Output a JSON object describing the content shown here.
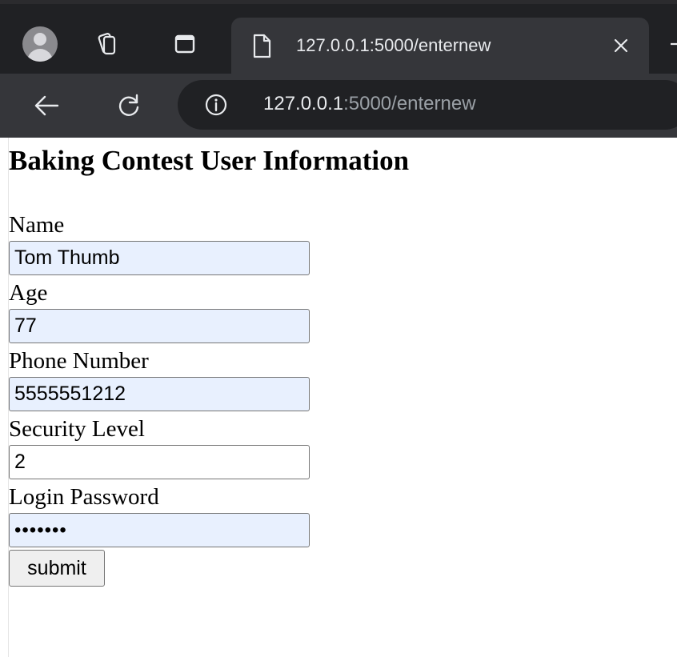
{
  "browser": {
    "tab_title": "127.0.0.1:5000/enternew",
    "url_host": "127.0.0.1",
    "url_rest": ":5000/enternew",
    "icons": [
      "profile-avatar",
      "collections-icon",
      "tab-actions-icon",
      "page-document-icon",
      "close-icon",
      "back-arrow-icon",
      "reload-icon",
      "site-info-icon"
    ]
  },
  "page": {
    "heading": "Baking Contest User Information",
    "fields": {
      "name": {
        "label": "Name",
        "value": "Tom Thumb"
      },
      "age": {
        "label": "Age",
        "value": "77"
      },
      "phone": {
        "label": "Phone Number",
        "value": "5555551212"
      },
      "security": {
        "label": "Security Level",
        "value": "2"
      },
      "password": {
        "label": "Login Password",
        "value": "•••••••"
      }
    },
    "submit_label": "submit"
  },
  "colors": {
    "chrome_dark": "#202124",
    "chrome_tab": "#35363a",
    "autofill_bg": "#e8f0fe"
  }
}
